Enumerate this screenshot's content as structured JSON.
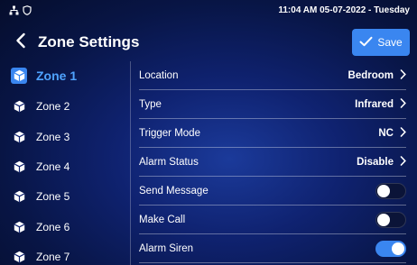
{
  "status": {
    "icons": [
      "network-icon",
      "shield-icon"
    ],
    "datetime": "11:04 AM 05-07-2022 - Tuesday"
  },
  "header": {
    "title": "Zone Settings",
    "save_label": "Save",
    "accent_color": "#3a86f0"
  },
  "sidebar": {
    "items": [
      {
        "label": "Zone 1",
        "active": true
      },
      {
        "label": "Zone 2",
        "active": false
      },
      {
        "label": "Zone 3",
        "active": false
      },
      {
        "label": "Zone 4",
        "active": false
      },
      {
        "label": "Zone 5",
        "active": false
      },
      {
        "label": "Zone 6",
        "active": false
      },
      {
        "label": "Zone 7",
        "active": false
      }
    ]
  },
  "settings": {
    "location": {
      "label": "Location",
      "value": "Bedroom"
    },
    "type": {
      "label": "Type",
      "value": "Infrared"
    },
    "trigger_mode": {
      "label": "Trigger Mode",
      "value": "NC"
    },
    "alarm_status": {
      "label": "Alarm Status",
      "value": "Disable"
    },
    "send_message": {
      "label": "Send Message",
      "on": false
    },
    "make_call": {
      "label": "Make Call",
      "on": false
    },
    "alarm_siren": {
      "label": "Alarm Siren",
      "on": true
    }
  }
}
